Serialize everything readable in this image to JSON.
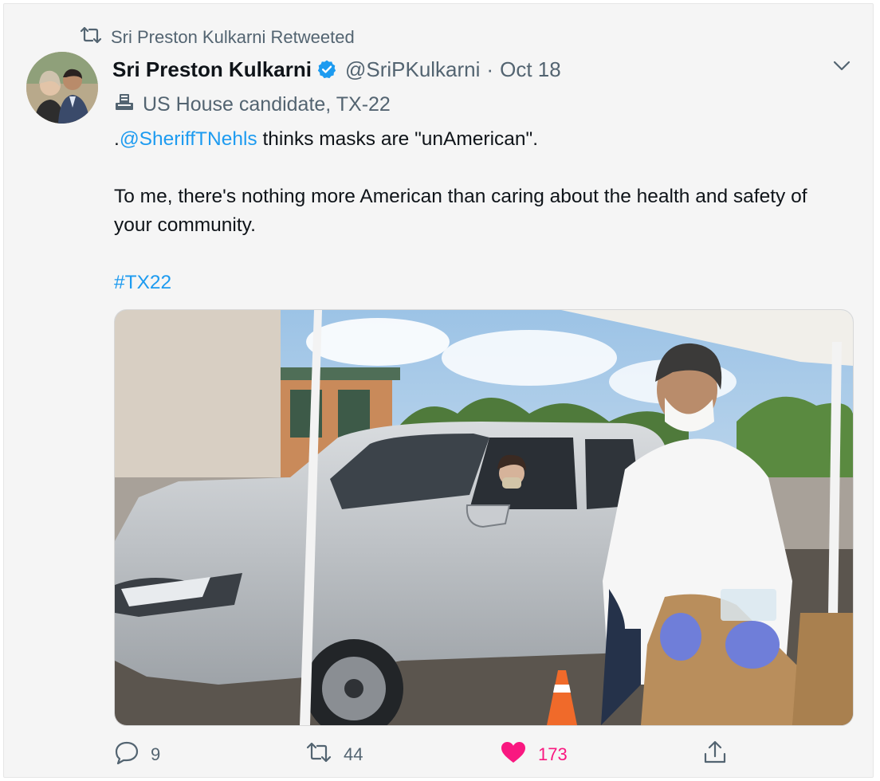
{
  "retweet_context": {
    "icon": "retweet-icon",
    "text": "Sri Preston Kulkarni Retweeted"
  },
  "tweet": {
    "author": {
      "name": "Sri Preston Kulkarni",
      "handle": "@SriPKulkarni",
      "verified": true,
      "avatar": "avatar-photo"
    },
    "separator": "·",
    "date": "Oct 18",
    "label": {
      "icon": "ballot-box-icon",
      "text": "US House candidate, TX-22"
    },
    "body": {
      "line1_prefix": ".",
      "mention": "@SheriffTNehls",
      "line1_rest": " thinks masks are \"unAmerican\".",
      "paragraph2": "To me, there's nothing more American than caring about the health and safety of your community.",
      "hashtag": "#TX22"
    },
    "media": {
      "type": "photo"
    },
    "actions": {
      "replies": "9",
      "retweets": "44",
      "likes": "173",
      "liked": true
    }
  },
  "colors": {
    "link": "#1d9bf0",
    "like": "#f91880",
    "secondary_text": "#536471",
    "verified": "#1d9bf0"
  }
}
